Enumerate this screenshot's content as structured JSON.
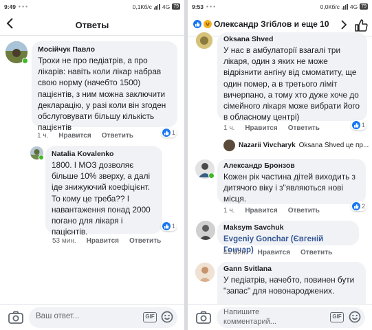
{
  "left": {
    "status": {
      "time": "9:49",
      "network": "0,1Кб/с",
      "signal": "4G",
      "battery": "79"
    },
    "header": {
      "title": "Ответы"
    },
    "comments": [
      {
        "name": "Мосійчук Павло",
        "text": "Трохи не про педіатрів, а про лікарів: навіть коли лікар набрав свою норму (начебто 1500) пацієнтів, з ним можна заключити декларацію, у разі коли він згоден обслуговувати більшу кількість пацієнтів",
        "time": "1 ч.",
        "like": "Нравится",
        "reply": "Ответить",
        "reactions": "1"
      },
      {
        "name": "Natalia Kovalenko",
        "text": "1800. І МОЗ дозволяє більше 10% зверху, а далі іде знижуючий коефіцієнт. То кому це треба?? І навантаження понад 2000 погано для лікаря і пацієнтів.",
        "time": "53 мин.",
        "like": "Нравится",
        "reply": "Ответить",
        "reactions": "1"
      }
    ],
    "composer": {
      "placeholder": "Ваш ответ...",
      "gif": "GIF"
    }
  },
  "right": {
    "status": {
      "time": "9:53",
      "network": "0,0Кб/с",
      "signal": "4G",
      "battery": "79"
    },
    "header": {
      "title": "Олександр Згіблов и еще 10"
    },
    "comments": [
      {
        "name": "Oksana Shved",
        "text": "У нас в амбулаторії взагалі три лікаря, один з яких не може відрізнити ангіну від смоматиту, ще один помер, а в третього ліміт вичерпано, а тому хто дуже хоче до сімейного лікаря може вибрати його в обласному центрі)",
        "time": "1 ч.",
        "like": "Нравится",
        "reply": "Ответить",
        "reactions": "1"
      },
      {
        "reply_preview_name": "Nazarii Vivcharyk",
        "reply_preview_text": "Oksana Shved  це пр..."
      },
      {
        "name": "Александр Бронзов",
        "text": "Кожен рік частина дітей виходить з дитячого віку і з\"являються нові місця.",
        "time": "1 ч.",
        "like": "Нравится",
        "reply": "Ответить",
        "reactions": "2"
      },
      {
        "name": "Maksym Savchuk",
        "mention": "Evgeniy Gonchar (Євгеній Гончар)",
        "time": "44 мин.",
        "like": "Нравится",
        "reply": "Ответить"
      },
      {
        "name": "Gann Svitlana",
        "text": "У педіатрів, начебто, повинен бути \"запас\" для новонароджених."
      }
    ],
    "composer": {
      "placeholder": "Напишите комментарий...",
      "gif": "GIF"
    }
  },
  "colors": {
    "link": "#385898",
    "like": "#1877f2",
    "bubble": "#f0f2f5",
    "online": "#42b72a"
  }
}
